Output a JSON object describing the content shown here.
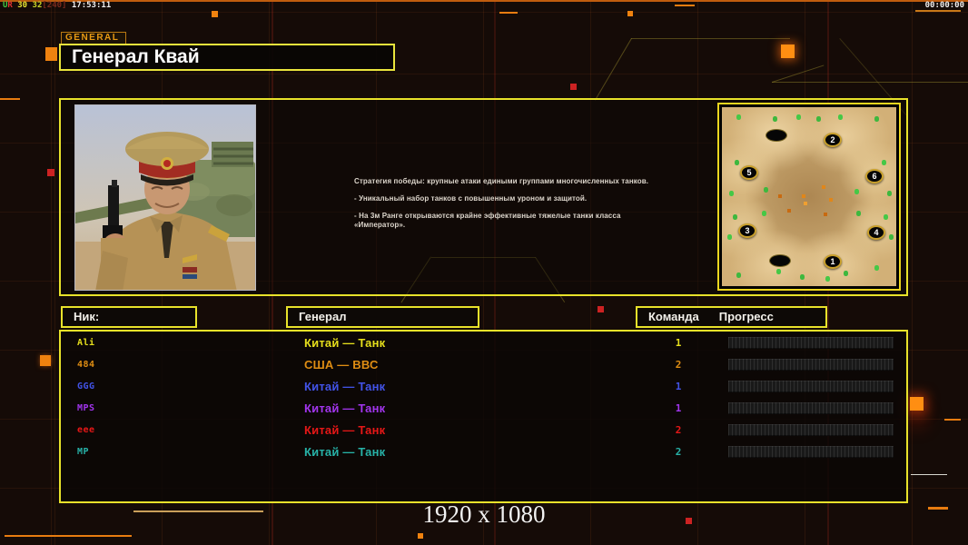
{
  "debug_overlay": {
    "segments": [
      {
        "text": "U",
        "color": "#44cc44"
      },
      {
        "text": "R",
        "color": "#dd3333"
      },
      {
        "text": " 30 ",
        "color": "#e8e232"
      },
      {
        "text": "32",
        "color": "#c8d428"
      },
      {
        "text": "[240]",
        "color": "#7a2a1e"
      },
      {
        "text": " 17:53:11",
        "color": "#f0eeee"
      }
    ]
  },
  "match_timer": "00:00:00",
  "header": {
    "tab_label": "GENERAL",
    "title": "Генерал Квай"
  },
  "briefing": {
    "lines": [
      "Стратегия победы: крупные атаки едиными группами многочисленных танков.",
      "- Уникальный набор танков с повышенным уроном и защитой.",
      "- На 3м Ранге открываются крайне эффективные тяжелые танки класса «Император»."
    ]
  },
  "map": {
    "spawn_labels": [
      "2",
      "5",
      "6",
      "3",
      "4",
      "1"
    ]
  },
  "roster": {
    "col_nick": "Ник:",
    "col_general": "Генерал",
    "col_team": "Команда",
    "col_progress": "Прогресс",
    "players": [
      {
        "name": "Ali",
        "general": "Китай — Танк",
        "team": "1",
        "color": "#e6df1c",
        "progress": 0
      },
      {
        "name": "484",
        "general": "США — ВВС",
        "team": "2",
        "color": "#df8d13",
        "progress": 0
      },
      {
        "name": "GGG",
        "general": "Китай — Танк",
        "team": "1",
        "color": "#4253e8",
        "progress": 0
      },
      {
        "name": "MPS",
        "general": "Китай — Танк",
        "team": "1",
        "color": "#a235ee",
        "progress": 0
      },
      {
        "name": "eee",
        "general": "Китай — Танк",
        "team": "2",
        "color": "#e61717",
        "progress": 0
      },
      {
        "name": "MP",
        "general": "Китай — Танк",
        "team": "2",
        "color": "#27b2a8",
        "progress": 0
      }
    ]
  },
  "footer": {
    "resolution_label": "1920 x 1080"
  },
  "theme": {
    "panel_border": "#e8e22a",
    "accent_orange": "#e87c10"
  }
}
